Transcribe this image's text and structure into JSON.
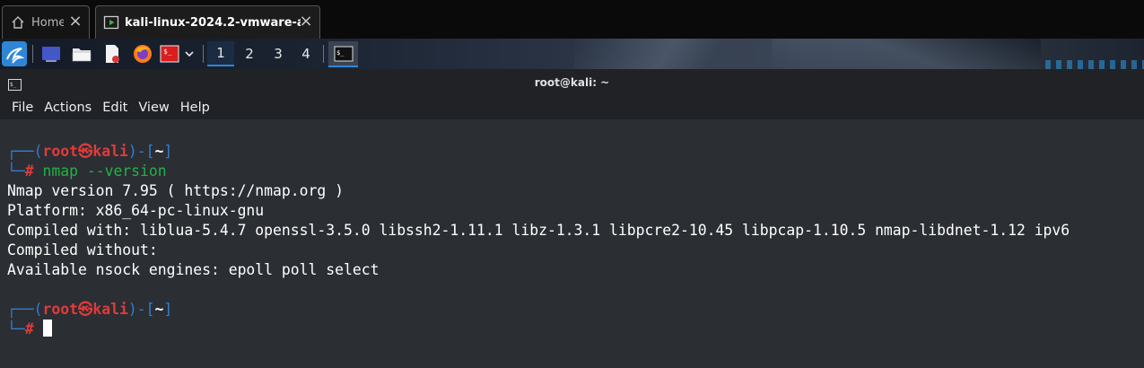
{
  "vm_tabs": [
    {
      "label": "Home",
      "icon": "home-icon"
    },
    {
      "label": "kali-linux-2024.2-vmware-a...",
      "icon": "vm-play-icon"
    }
  ],
  "panel": {
    "apps": [
      "kali-dragon-icon",
      "desktop-icon",
      "file-manager-icon",
      "text-editor-icon",
      "firefox-icon",
      "terminal-app-icon",
      "dropdown-chevron-icon"
    ],
    "workspaces": [
      "1",
      "2",
      "3",
      "4"
    ],
    "active_workspace": "1"
  },
  "window": {
    "title": "root@kali: ~"
  },
  "menu": [
    "File",
    "Actions",
    "Edit",
    "View",
    "Help"
  ],
  "terminal": {
    "prompt1": {
      "box_top": "┌──(",
      "user": "root",
      "at": "㉿",
      "host": "kali",
      "mid": ")-[",
      "dir": "~",
      "end": "]",
      "box_bottom": "└─",
      "hash": "#",
      "command": "nmap --version"
    },
    "output": [
      "Nmap version 7.95 ( https://nmap.org )",
      "Platform: x86_64-pc-linux-gnu",
      "Compiled with: liblua-5.4.7 openssl-3.5.0 libssh2-1.11.1 libz-1.3.1 libpcre2-10.45 libpcap-1.10.5 nmap-libdnet-1.12 ipv6",
      "Compiled without:",
      "Available nsock engines: epoll poll select"
    ],
    "prompt2": {
      "box_top": "┌──(",
      "user": "root",
      "at": "㉿",
      "host": "kali",
      "mid": ")-[",
      "dir": "~",
      "end": "]",
      "box_bottom": "└─",
      "hash": "#"
    }
  },
  "colors": {
    "prompt_box": "#2f7fd3",
    "prompt_user": "#e03b3b",
    "command": "#24b247",
    "terminal_bg": "#2b2e33"
  }
}
